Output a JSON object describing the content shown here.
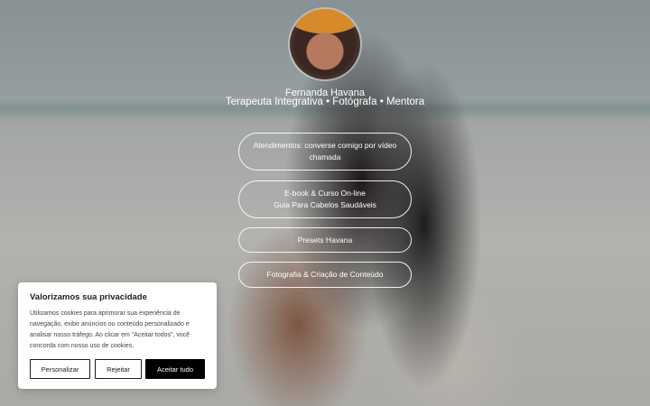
{
  "profile": {
    "name": "Fernanda Havana",
    "tagline": "Terapeuta Integrativa • Fotógrafa • Mentora"
  },
  "links": [
    {
      "line1": "Atendimentos: converse comigo por vídeo",
      "line2": "chamada"
    },
    {
      "line1": "E-book & Curso On-line",
      "line2": "Guia Para Cabelos Saudáveis"
    },
    {
      "line1": "Presets Havana"
    },
    {
      "line1": "Fotografia & Criação de Conteúdo"
    }
  ],
  "cookie": {
    "title": "Valorizamos sua privacidade",
    "text": "Utilizamos cookies para aprimorar sua experiência de navegação, exibir anúncios ou conteúdo personalizado e analisar nosso tráfego. Ao clicar em “Aceitar todos”, você concorda com nosso uso de cookies.",
    "customize_label": "Personalizar",
    "reject_label": "Rejeitar",
    "accept_label": "Aceitar tudo"
  }
}
